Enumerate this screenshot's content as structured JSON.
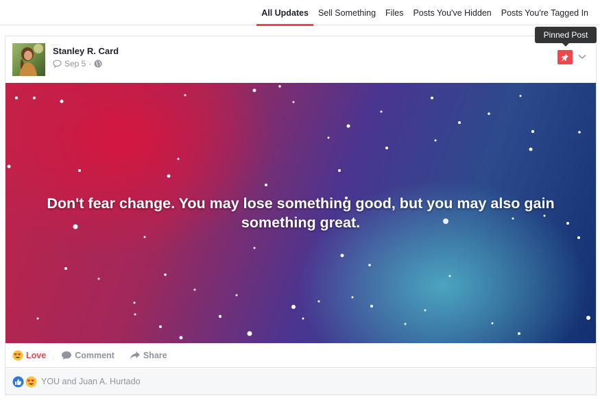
{
  "tabs": [
    {
      "label": "All Updates",
      "active": true
    },
    {
      "label": "Sell Something"
    },
    {
      "label": "Files"
    },
    {
      "label": "Posts You've Hidden"
    },
    {
      "label": "Posts You're Tagged In"
    }
  ],
  "post": {
    "author": "Stanley R. Card",
    "date": "Sep 5",
    "date_separator": "·",
    "privacy_icon": "globe-icon",
    "meta_icon": "comment-bubble-icon",
    "pin_tooltip": "Pinned Post",
    "pin_color": "#f0474f",
    "quote": "Don't fear change. You may lose something good, but you may also gain something great.",
    "actions": {
      "love_label": "Love",
      "comment_label": "Comment",
      "share_label": "Share"
    },
    "reactions_text": "YOU and Juan A. Hurtado",
    "accent_color": "#e7454f"
  }
}
